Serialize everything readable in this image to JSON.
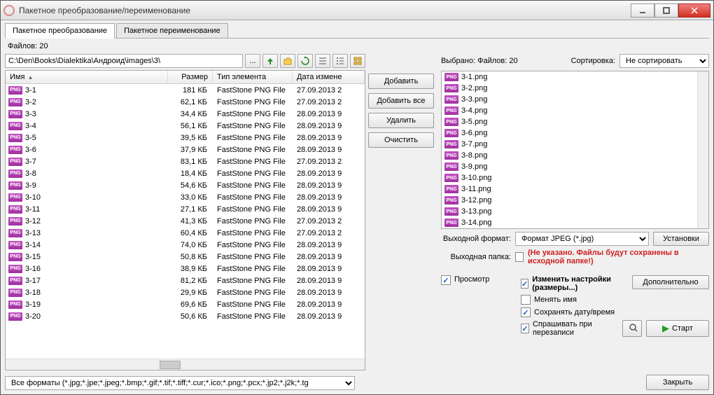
{
  "window": {
    "title": "Пакетное преобразование/переименование"
  },
  "tabs": {
    "convert": "Пакетное преобразование",
    "rename": "Пакетное переименование"
  },
  "file_count_label": "Файлов: 20",
  "path": "C:\\Den\\Books\\Dialektika\\Андроид\\images\\3\\",
  "browse_label": "...",
  "columns": {
    "name": "Имя",
    "size": "Размер",
    "type": "Тип элемента",
    "date": "Дата измене"
  },
  "files": [
    {
      "name": "3-1",
      "size": "181 КБ",
      "type": "FastStone PNG File",
      "date": "27.09.2013 2"
    },
    {
      "name": "3-2",
      "size": "62,1 КБ",
      "type": "FastStone PNG File",
      "date": "27.09.2013 2"
    },
    {
      "name": "3-3",
      "size": "34,4 КБ",
      "type": "FastStone PNG File",
      "date": "28.09.2013 9"
    },
    {
      "name": "3-4",
      "size": "56,1 КБ",
      "type": "FastStone PNG File",
      "date": "28.09.2013 9"
    },
    {
      "name": "3-5",
      "size": "39,5 КБ",
      "type": "FastStone PNG File",
      "date": "28.09.2013 9"
    },
    {
      "name": "3-6",
      "size": "37,9 КБ",
      "type": "FastStone PNG File",
      "date": "28.09.2013 9"
    },
    {
      "name": "3-7",
      "size": "83,1 КБ",
      "type": "FastStone PNG File",
      "date": "27.09.2013 2"
    },
    {
      "name": "3-8",
      "size": "18,4 КБ",
      "type": "FastStone PNG File",
      "date": "28.09.2013 9"
    },
    {
      "name": "3-9",
      "size": "54,6 КБ",
      "type": "FastStone PNG File",
      "date": "28.09.2013 9"
    },
    {
      "name": "3-10",
      "size": "33,0 КБ",
      "type": "FastStone PNG File",
      "date": "28.09.2013 9"
    },
    {
      "name": "3-11",
      "size": "27,1 КБ",
      "type": "FastStone PNG File",
      "date": "28.09.2013 9"
    },
    {
      "name": "3-12",
      "size": "41,3 КБ",
      "type": "FastStone PNG File",
      "date": "27.09.2013 2"
    },
    {
      "name": "3-13",
      "size": "60,4 КБ",
      "type": "FastStone PNG File",
      "date": "27.09.2013 2"
    },
    {
      "name": "3-14",
      "size": "74,0 КБ",
      "type": "FastStone PNG File",
      "date": "28.09.2013 9"
    },
    {
      "name": "3-15",
      "size": "50,8 КБ",
      "type": "FastStone PNG File",
      "date": "28.09.2013 9"
    },
    {
      "name": "3-16",
      "size": "38,9 КБ",
      "type": "FastStone PNG File",
      "date": "28.09.2013 9"
    },
    {
      "name": "3-17",
      "size": "81,2 КБ",
      "type": "FastStone PNG File",
      "date": "28.09.2013 9"
    },
    {
      "name": "3-18",
      "size": "29,9 КБ",
      "type": "FastStone PNG File",
      "date": "28.09.2013 9"
    },
    {
      "name": "3-19",
      "size": "69,6 КБ",
      "type": "FastStone PNG File",
      "date": "28.09.2013 9"
    },
    {
      "name": "3-20",
      "size": "50,6 КБ",
      "type": "FastStone PNG File",
      "date": "28.09.2013 9"
    }
  ],
  "mid_buttons": {
    "add": "Добавить",
    "add_all": "Добавить все",
    "remove": "Удалить",
    "clear": "Очистить"
  },
  "selected_label": "Выбрано:  Файлов: 20",
  "sort_label": "Сортировка:",
  "sort_value": "Не сортировать",
  "selected_files": [
    "3-1.png",
    "3-2.png",
    "3-3.png",
    "3-4.png",
    "3-5.png",
    "3-6.png",
    "3-7.png",
    "3-8.png",
    "3-9.png",
    "3-10.png",
    "3-11.png",
    "3-12.png",
    "3-13.png",
    "3-14.png"
  ],
  "out_format_label": "Выходной формат:",
  "out_format_value": "Формат JPEG (*.jpg)",
  "settings_btn": "Установки",
  "out_folder_label": "Выходная папка:",
  "out_folder_warn": "(Не указано. Файлы будут сохранены в исходной папке!)",
  "preview_chk": "Просмотр",
  "checks": {
    "resize": "Изменить настройки (размеры...)",
    "rename": "Менять имя",
    "keep_date": "Сохранять дату/время",
    "ask_overwrite": "Спрашивать при перезаписи"
  },
  "advanced_btn": "Дополнительно",
  "start_btn": "Старт",
  "close_btn": "Закрыть",
  "formats_filter": "Все форматы (*.jpg;*.jpe;*.jpeg;*.bmp;*.gif;*.tif;*.tiff;*.cur;*.ico;*.png;*.pcx;*.jp2;*.j2k;*.tg"
}
